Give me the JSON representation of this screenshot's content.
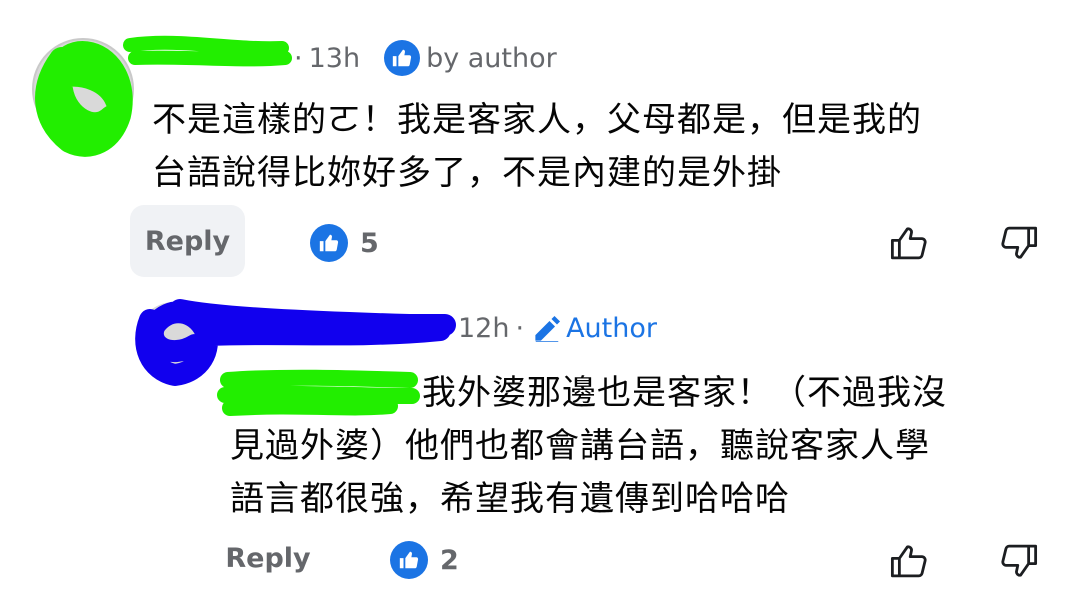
{
  "comment": {
    "time": "13h",
    "badge_label": "by author",
    "text_lines": [
      "不是這樣的ㄛ！我是客家人，父母都是，但是我的",
      "台語說得比妳好多了，不是內建的是外掛"
    ],
    "reply_label": "Reply",
    "like_count": "5",
    "icons": [
      "thumbs-up-badge-icon",
      "thumbs-up-outline-icon",
      "thumbs-down-outline-icon"
    ]
  },
  "reply": {
    "time": "12h",
    "badge_label": "Author",
    "text_lines": [
      "我外婆那邊也是客家！（不過我沒",
      "見過外婆）他們也都會講台語，聽說客家人學",
      "語言都很強，希望我有遺傳到哈哈哈"
    ],
    "reply_label": "Reply",
    "like_count": "2",
    "icons": [
      "pencil-icon",
      "thumbs-up-badge-icon",
      "thumbs-up-outline-icon",
      "thumbs-down-outline-icon"
    ]
  },
  "colors": {
    "accent_blue": "#1b74e4",
    "meta_gray": "#65676b",
    "redaction_green": "#22ee00",
    "redaction_blue": "#1100ee"
  }
}
